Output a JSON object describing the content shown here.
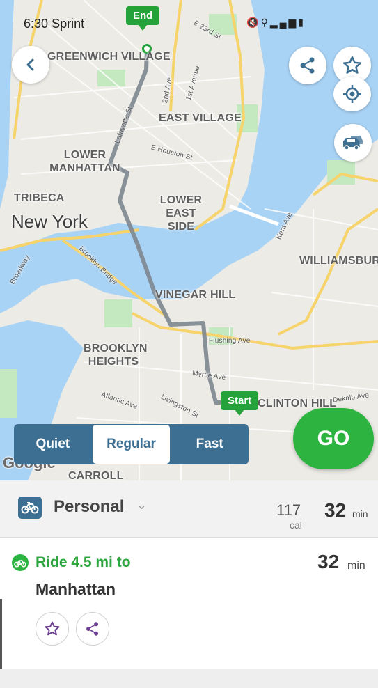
{
  "status_bar": {
    "time": "6:30",
    "carrier": "Sprint",
    "icons": [
      "mute-icon",
      "location-icon",
      "lte-signal-icon",
      "battery-icon"
    ]
  },
  "map": {
    "neighborhood_labels": [
      "GREENWICH VILLAGE",
      "EAST VILLAGE",
      "LOWER MANHATTAN",
      "LOWER EAST SIDE",
      "TRIBECA",
      "New York",
      "WILLIAMSBURG",
      "VINEGAR HILL",
      "BROOKLYN HEIGHTS",
      "CLINTON HILL",
      "CARROLL"
    ],
    "street_labels": [
      "E 23rd St",
      "2nd Ave",
      "1st Avenue",
      "Lafayette St",
      "E Houston St",
      "Kent Ave",
      "Brooklyn Bridge",
      "Broadway",
      "Flushing Ave",
      "Myrtle Ave",
      "Atlantic Ave",
      "Livingston St",
      "Dekalb Ave"
    ],
    "start_pin": "Start",
    "end_pin": "End",
    "attribution": "Google"
  },
  "map_buttons": {
    "back": "back-icon",
    "share": "share-icon",
    "favorite": "star-icon",
    "locate": "locate-icon",
    "traffic": "traffic-icon"
  },
  "route_options": {
    "items": [
      "Quiet",
      "Regular",
      "Fast"
    ],
    "selected": "Regular"
  },
  "go_button": "GO",
  "mode": {
    "name": "Personal",
    "calories": "117",
    "calories_unit": "cal",
    "duration": "32",
    "duration_unit": "min"
  },
  "step": {
    "title": "Ride 4.5 mi to",
    "destination": "Manhattan",
    "duration": "32",
    "duration_unit": "min"
  },
  "colors": {
    "accent_green": "#2db340",
    "route_blue": "#3d6f93",
    "water": "#a9d3f5",
    "park": "#c4e8c0",
    "major_road": "#f6d36b"
  }
}
